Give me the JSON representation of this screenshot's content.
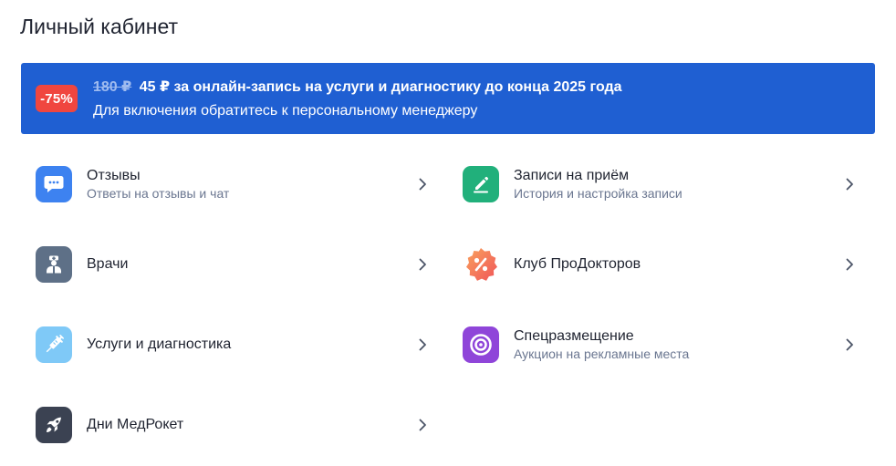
{
  "page": {
    "title": "Личный кабинет"
  },
  "promo": {
    "badge": "-75%",
    "old_price": "180 ₽",
    "headline": "45 ₽ за онлайн-запись на услуги и диагностику до конца 2025 года",
    "subline": "Для включения обратитесь к персональному менеджеру",
    "background_color": "#1f5fd2",
    "badge_color": "#f0463f"
  },
  "menu": {
    "reviews": {
      "title": "Отзывы",
      "subtitle": "Ответы на отзывы и чат",
      "icon": "chat-bubble-icon",
      "icon_color": "#3d82f0"
    },
    "appointments": {
      "title": "Записи на приём",
      "subtitle": "История и настройка записи",
      "icon": "edit-pen-icon",
      "icon_color": "#21b07b"
    },
    "doctors": {
      "title": "Врачи",
      "icon": "doctor-icon",
      "icon_color": "#5e7087"
    },
    "club": {
      "title": "Клуб ПроДокторов",
      "icon": "percent-badge-icon",
      "icon_color": "#f47a5a"
    },
    "services": {
      "title": "Услуги и диагностика",
      "icon": "syringe-icon",
      "icon_color": "#7fc9f7"
    },
    "placement": {
      "title": "Спецразмещение",
      "subtitle": "Аукцион на рекламные места",
      "icon": "target-icon",
      "icon_color": "#8f45d9"
    },
    "medrocket": {
      "title": "Дни МедРокет",
      "icon": "rocket-icon",
      "icon_color": "#3b4252"
    }
  }
}
